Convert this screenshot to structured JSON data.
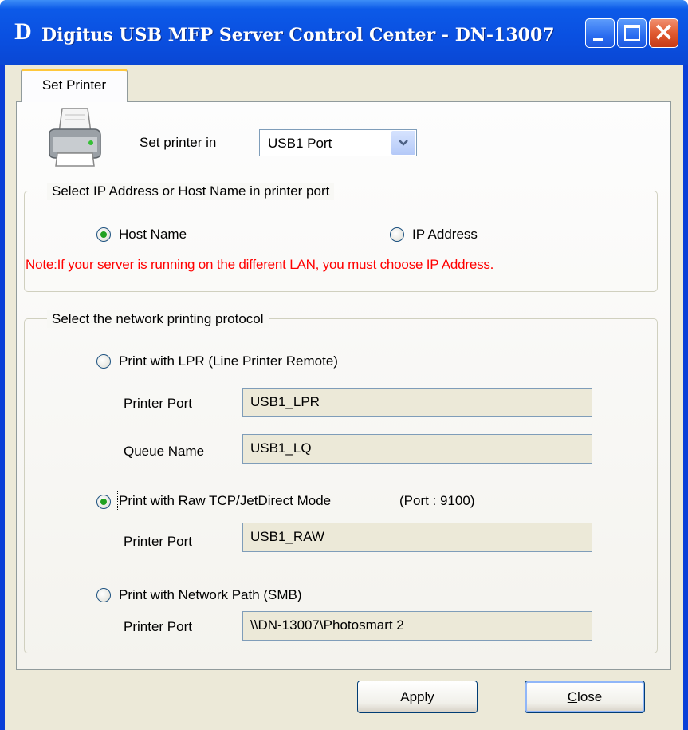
{
  "window": {
    "title": "Digitus USB MFP Server Control Center - DN-13007",
    "icon_letter": "D",
    "controls": {
      "minimize": "minimize-icon",
      "maximize": "maximize-icon",
      "close_glyph": "✕"
    }
  },
  "tab": {
    "label": "Set Printer"
  },
  "set_printer": {
    "label": "Set printer in",
    "selected_port": "USB1 Port",
    "icon": "printer-icon"
  },
  "address_group": {
    "legend": "Select IP Address or Host Name in printer port",
    "host_name": {
      "label": "Host Name",
      "checked": true
    },
    "ip_address": {
      "label": "IP Address",
      "checked": false
    },
    "note": "Note:If your server is running on the different LAN, you must choose IP Address."
  },
  "protocol_group": {
    "legend": "Select the network printing protocol",
    "lpr": {
      "label": "Print with LPR (Line Printer Remote)",
      "checked": false,
      "port_label": "Printer Port",
      "port_value": "USB1_LPR",
      "queue_label": "Queue Name",
      "queue_value": "USB1_LQ"
    },
    "raw": {
      "label": "Print with Raw TCP/JetDirect Mode",
      "port_note": "(Port : 9100)",
      "checked": true,
      "port_label": "Printer Port",
      "port_value": "USB1_RAW"
    },
    "smb": {
      "label": "Print with Network Path (SMB)",
      "checked": false,
      "port_label": "Printer Port",
      "port_value": "\\\\DN-13007\\Photosmart 2"
    }
  },
  "buttons": {
    "apply": "Apply",
    "close_first": "C",
    "close_rest": "lose"
  },
  "colors": {
    "titlebar": "#0a4fe0",
    "note": "#ff0000",
    "radio_dot": "#21a121",
    "client_bg": "#ece9d8"
  }
}
